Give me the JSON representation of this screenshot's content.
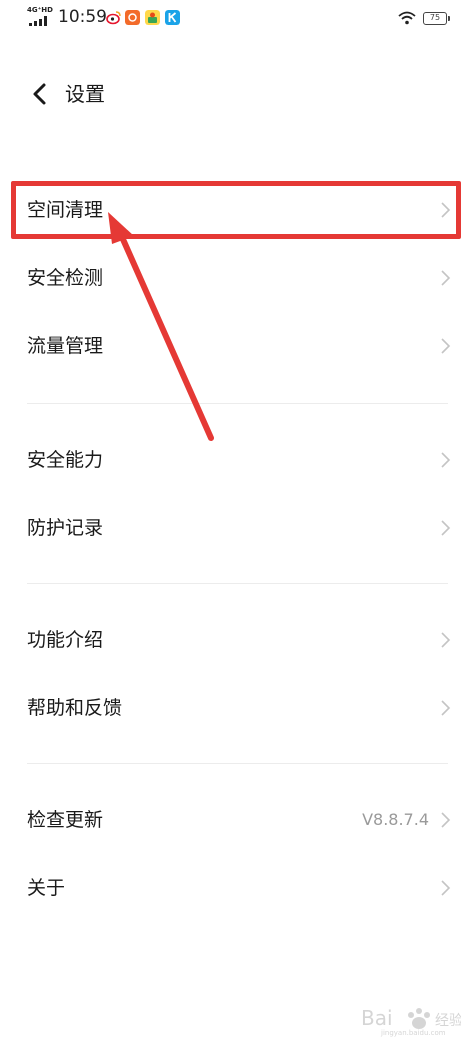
{
  "status_bar": {
    "network": "4G⁺HD",
    "time": "10:59",
    "battery": "75",
    "icons": [
      "signal-icon",
      "weibo-app-icon",
      "orange-app-icon",
      "yellow-app-icon",
      "blue-k-app-icon",
      "wifi-icon",
      "battery-icon"
    ]
  },
  "header": {
    "title": "设置",
    "back_icon": "chevron-left-icon"
  },
  "groups": [
    {
      "items": [
        {
          "label": "空间清理"
        },
        {
          "label": "安全检测"
        },
        {
          "label": "流量管理"
        }
      ]
    },
    {
      "items": [
        {
          "label": "安全能力"
        },
        {
          "label": "防护记录"
        }
      ]
    },
    {
      "items": [
        {
          "label": "功能介绍"
        },
        {
          "label": "帮助和反馈"
        }
      ]
    },
    {
      "items": [
        {
          "label": "检查更新",
          "value": "V8.8.7.4"
        },
        {
          "label": "关于"
        }
      ]
    }
  ],
  "colors": {
    "annotation": "#e53935",
    "chevron": "#c4c4c4",
    "value_text": "#9a9a9a",
    "divider": "#ececec"
  }
}
